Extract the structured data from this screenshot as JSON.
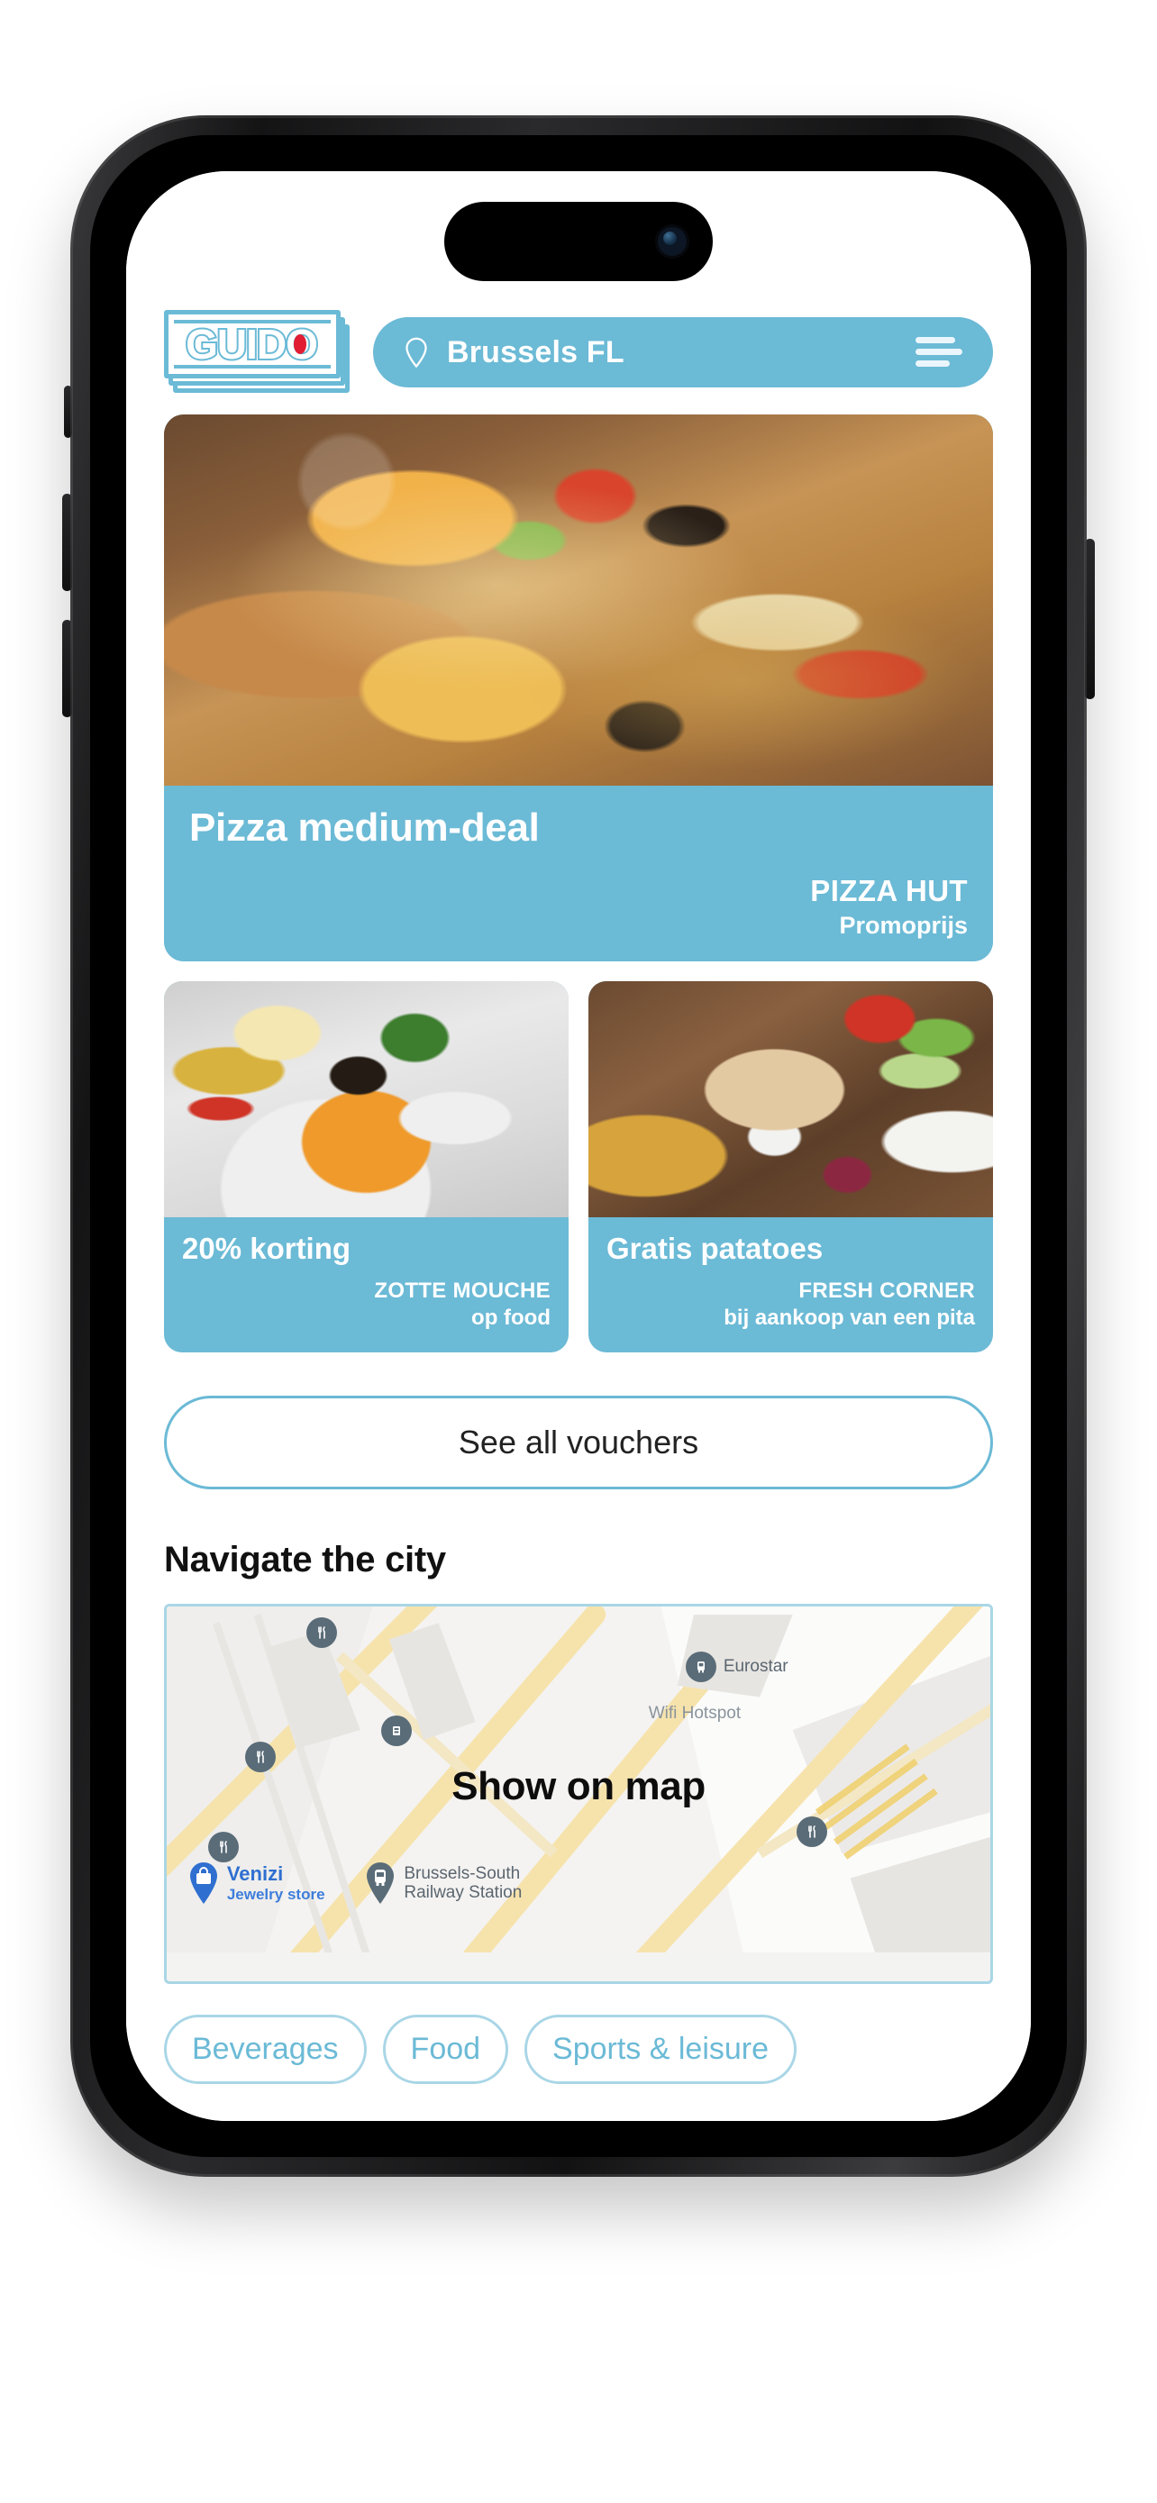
{
  "app": {
    "logo_text": "GUIDO",
    "location": "Brussels FL"
  },
  "header": {
    "location_pin_icon": "location-pin-icon",
    "menu_icon": "hamburger-menu-icon",
    "accent_color": "#6bbad6"
  },
  "hero_voucher": {
    "title": "Pizza medium-deal",
    "brand": "PIZZA HUT",
    "subtitle": "Promoprijs",
    "image_alt": "pizza"
  },
  "vouchers": [
    {
      "title": "20% korting",
      "brand": "ZOTTE MOUCHE",
      "subtitle": "op food",
      "image_alt": "pasta"
    },
    {
      "title": "Gratis patatoes",
      "brand": "FRESH CORNER",
      "subtitle": "bij aankoop van een pita",
      "image_alt": "pita"
    }
  ],
  "see_all_button": {
    "label": "See all vouchers"
  },
  "navigate": {
    "section_title": "Navigate the city",
    "map_cta": "Show on map",
    "pois": [
      {
        "name": "Venizi",
        "category": "Jewelry store",
        "icon": "shop-pin-icon"
      },
      {
        "name": "Brussels-South Railway Station",
        "icon": "train-pin-icon"
      },
      {
        "name": "Eurostar",
        "icon": "train-circle-icon"
      },
      {
        "name": "Wifi Hotspot",
        "icon": "wifi-label"
      }
    ]
  },
  "categories": [
    {
      "label": "Beverages"
    },
    {
      "label": "Food"
    },
    {
      "label": "Sports & leisure"
    }
  ]
}
